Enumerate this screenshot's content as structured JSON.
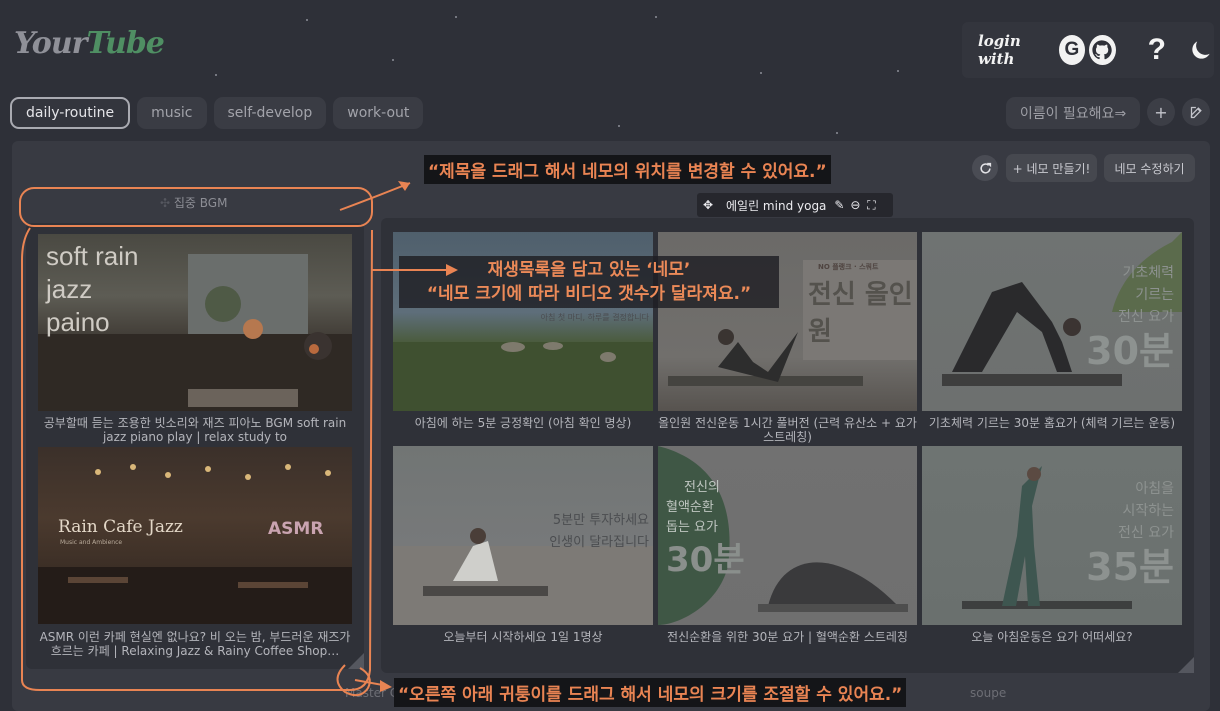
{
  "header": {
    "logo_your": "Your",
    "logo_tube": "Tube",
    "login_label": "login with",
    "google_glyph": "G",
    "help_glyph": "?"
  },
  "tabs": [
    {
      "label": "daily-routine",
      "active": true
    },
    {
      "label": "music",
      "active": false
    },
    {
      "label": "self-develop",
      "active": false
    },
    {
      "label": "work-out",
      "active": false
    }
  ],
  "toolbar": {
    "name_button": "이름이 필요해요⇒",
    "add_glyph": "+",
    "create_box": "+ 네모 만들기!",
    "edit_boxes": "네모 수정하기"
  },
  "boxes": {
    "left": {
      "title": "집중 BGM",
      "videos": [
        {
          "caption": "공부할때 듣는 조용한 빗소리와 재즈 피아노 BGM soft rain jazz piano play | relax study to",
          "thumb_text": [
            "soft rain",
            "jazz",
            "paino"
          ]
        },
        {
          "caption": "ASMR 이런 카페 현실엔 없나요? 비 오는 밤, 부드러운 재즈가 흐르는 카페 | Relaxing Jazz & Rainy Coffee Shop…",
          "thumb_text": [
            "Rain Cafe Jazz",
            "Music and Ambience",
            "ASMR"
          ]
        }
      ]
    },
    "right": {
      "title": "에일린 mind yoga",
      "videos": [
        {
          "caption": "아침에 하는 5분 긍정확인 (아침 확인 명상)",
          "thumb_text": [
            "아침 첫 마디, 하루를 결정합니다"
          ]
        },
        {
          "caption": "올인원 전신운동 1시간 풀버전 (근력 유산소 + 요가 스트레칭)",
          "thumb_text": [
            "NO 플랭크 · 스쿼트",
            "전신 올인원"
          ]
        },
        {
          "caption": "기초체력 기르는 30분 홈요가 (체력 기르는 운동)",
          "thumb_text": [
            "기초체력",
            "기르는",
            "전신 요가",
            "30분"
          ]
        },
        {
          "caption": "오늘부터 시작하세요 1일 1명상",
          "thumb_text": [
            "5분만 투자하세요",
            "인생이 달라집니다"
          ]
        },
        {
          "caption": "전신순환을 위한 30분 요가 | 혈액순환 스트레칭",
          "thumb_text": [
            "전신의",
            "혈액순환",
            "돕는 요가",
            "30분"
          ]
        },
        {
          "caption": "오늘 아침운동은 요가 어떠세요?",
          "thumb_text": [
            "아침을",
            "시작하는",
            "전신 요가",
            "35분"
          ]
        }
      ]
    },
    "bottom_titles": [
      "Master Ch",
      "soupe"
    ]
  },
  "annotations": {
    "drag_title": "“제목을 드래그 해서 네모의 위치를 변경할 수 있어요.”",
    "box_desc_1": "재생목록을 담고 있는 ‘네모’",
    "box_desc_2": "“네모 크기에 따라 비디오 갯수가 달라져요.”",
    "resize": "“오른쪽 아래 귀퉁이를 드래그 해서 네모의 크기를 조절할 수 있어요.”"
  },
  "colors": {
    "background": "#2e3038",
    "annotation": "#e98453",
    "logo_accent": "#4f8f63"
  }
}
